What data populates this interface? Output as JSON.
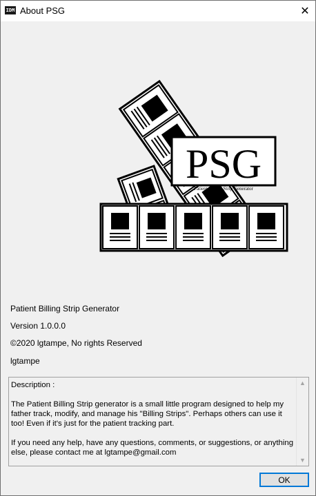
{
  "window": {
    "title": "About PSG",
    "app_icon_text": "IDM",
    "close_glyph": "✕"
  },
  "logo": {
    "big_text": "PSG",
    "subtitle": "Patient Billing Strip Generator"
  },
  "info": {
    "product": "Patient Billing Strip Generator",
    "version": "Version 1.0.0.0",
    "copyright": "©2020 lgtampe, No rights Reserved",
    "company": "lgtampe"
  },
  "description": {
    "text": "Description :\n\nThe Patient Billing Strip generator is a small little program designed to help my father track, modify, and manage his \"Billing Strips\". Perhaps others can use it too! Even if it's just for the patient tracking part.\n\nIf you need any help, have any questions, comments, or suggestions, or anything else, please contact me at lgtampe@gmail.com"
  },
  "buttons": {
    "ok_label": "OK"
  }
}
